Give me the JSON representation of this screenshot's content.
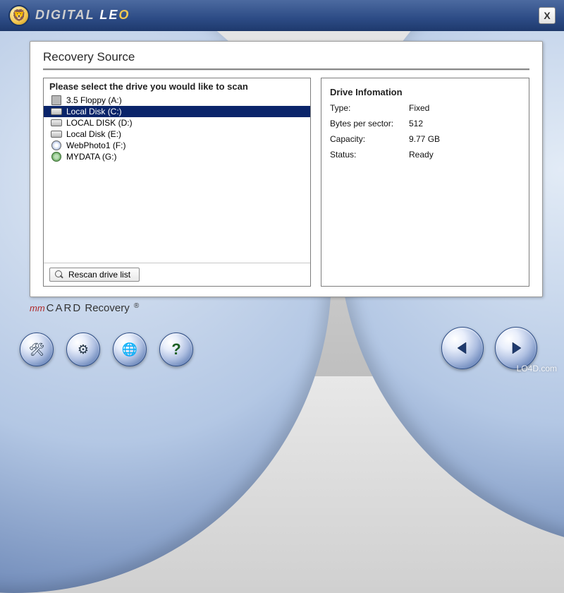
{
  "brand": {
    "text_1": "DIGITAL ",
    "text_2": "LE",
    "text_3": "O"
  },
  "close_label": "X",
  "panel_title": "Recovery Source",
  "drive_prompt": "Please select the drive you would like to scan",
  "drives": [
    {
      "label": "3.5 Floppy (A:)",
      "icon": "floppy",
      "selected": false
    },
    {
      "label": "Local Disk (C:)",
      "icon": "disk",
      "selected": true
    },
    {
      "label": "LOCAL DISK (D:)",
      "icon": "disk",
      "selected": false
    },
    {
      "label": "Local Disk (E:)",
      "icon": "disk",
      "selected": false
    },
    {
      "label": "WebPhoto1 (F:)",
      "icon": "cd",
      "selected": false
    },
    {
      "label": "MYDATA (G:)",
      "icon": "net",
      "selected": false
    }
  ],
  "rescan_label": "Rescan drive list",
  "info_header": "Drive Infomation",
  "info": {
    "type_k": "Type:",
    "type_v": "Fixed",
    "bps_k": "Bytes per sector:",
    "bps_v": "512",
    "cap_k": "Capacity:",
    "cap_v": "9.77 GB",
    "status_k": "Status:",
    "status_v": "Ready"
  },
  "product": {
    "mm": "mm",
    "card": "CARD",
    "rest": " Recovery ",
    "reg": "®"
  },
  "toolbar": {
    "b1": "tools",
    "b2": "settings",
    "b3": "update",
    "b4": "help"
  },
  "nav": {
    "prev": "Previous",
    "next": "Next"
  },
  "watermark": "LO4D.com"
}
